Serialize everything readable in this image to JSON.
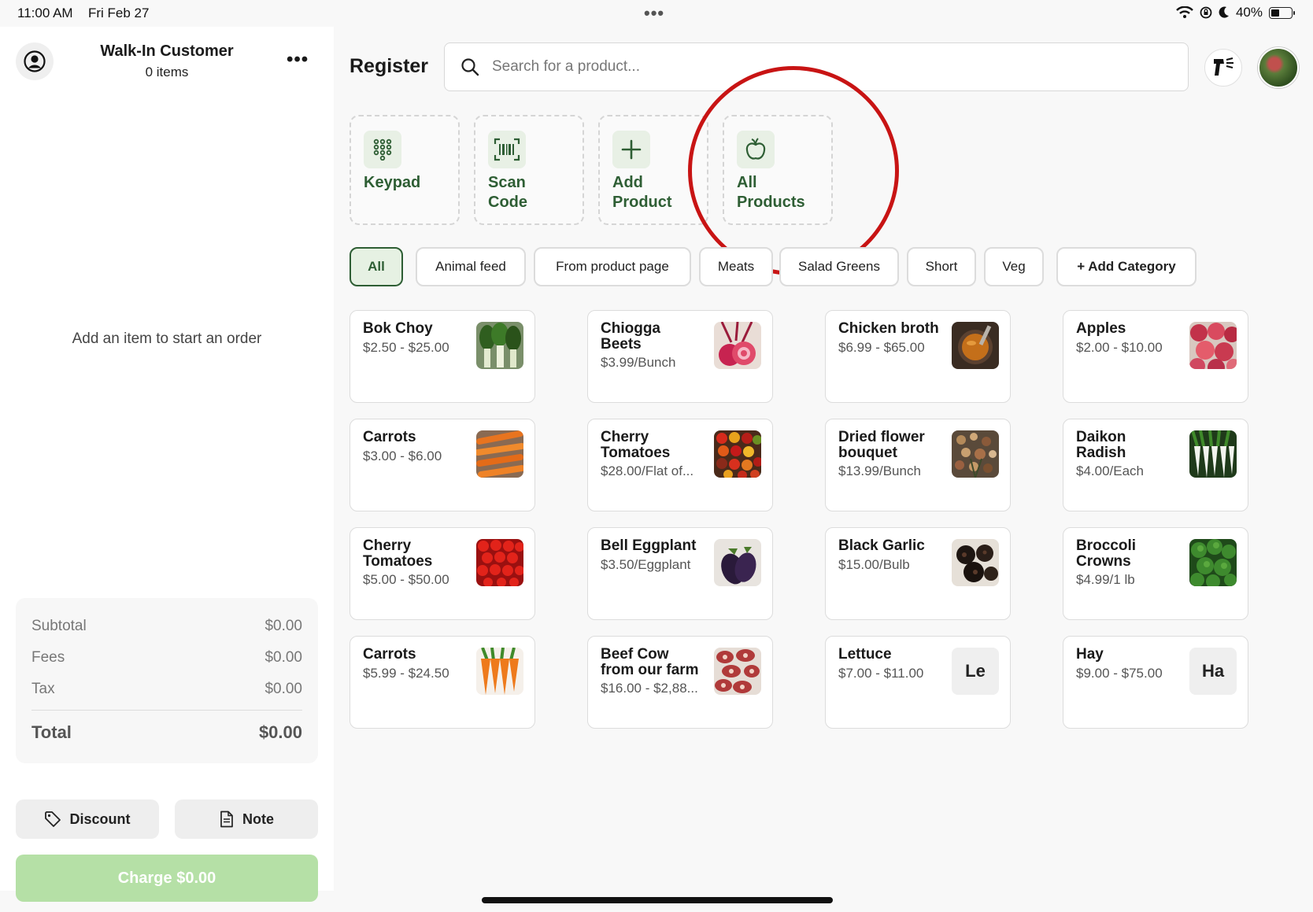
{
  "status": {
    "time": "11:00 AM",
    "date": "Fri Feb 27",
    "multitask": "•••",
    "battery": "40%",
    "battery_level": 0.4
  },
  "customer": {
    "name": "Walk-In Customer",
    "items": "0 items",
    "more": "•••"
  },
  "order": {
    "empty_message": "Add an item to start an order",
    "totals": [
      {
        "label": "Subtotal",
        "value": "$0.00"
      },
      {
        "label": "Fees",
        "value": "$0.00"
      },
      {
        "label": "Tax",
        "value": "$0.00"
      }
    ],
    "total_label": "Total",
    "total_value": "$0.00",
    "discount_label": "Discount",
    "note_label": "Note",
    "charge_label": "Charge $0.00"
  },
  "header": {
    "title": "Register",
    "search_placeholder": "Search for a product..."
  },
  "tiles": [
    {
      "line1": "Keypad",
      "line2": "",
      "icon": "keypad-icon"
    },
    {
      "line1": "Scan",
      "line2": "Code",
      "icon": "barcode-icon"
    },
    {
      "line1": "Add",
      "line2": "Product",
      "icon": "plus-icon"
    },
    {
      "line1": "All",
      "line2": "Products",
      "icon": "apple-icon"
    }
  ],
  "categories": [
    "All",
    "Animal feed",
    "From product page",
    "Meats",
    "Salad Greens",
    "Short",
    "Veg"
  ],
  "add_category": "+ Add Category",
  "colors": {
    "brand_green": "#2e5e34",
    "charge_disabled": "#b5e0a6",
    "annotation_red": "#c81414"
  },
  "products": [
    {
      "l1": "Bok Choy",
      "l2": "",
      "price": "$2.50 - $25.00",
      "img": "bokchoy"
    },
    {
      "l1": "Chiogga",
      "l2": "Beets",
      "price": "$3.99/Bunch",
      "img": "beets"
    },
    {
      "l1": "Chicken broth",
      "l2": "",
      "price": "$6.99 - $65.00",
      "img": "broth"
    },
    {
      "l1": "Apples",
      "l2": "",
      "price": "$2.00 - $10.00",
      "img": "apples"
    },
    {
      "l1": "Carrots",
      "l2": "",
      "price": "$3.00 - $6.00",
      "img": "carrots1"
    },
    {
      "l1": "Cherry",
      "l2": "Tomatoes",
      "price": "$28.00/Flat of...",
      "img": "cherrymix"
    },
    {
      "l1": "Dried flower",
      "l2": "bouquet",
      "price": "$13.99/Bunch",
      "img": "flowers"
    },
    {
      "l1": "Daikon",
      "l2": "Radish",
      "price": "$4.00/Each",
      "img": "daikon"
    },
    {
      "l1": "Cherry",
      "l2": "Tomatoes",
      "price": "$5.00 - $50.00",
      "img": "cherryred"
    },
    {
      "l1": "Bell Eggplant",
      "l2": "",
      "price": "$3.50/Eggplant",
      "img": "eggplant"
    },
    {
      "l1": "Black Garlic",
      "l2": "",
      "price": "$15.00/Bulb",
      "img": "garlic"
    },
    {
      "l1": "Broccoli",
      "l2": "Crowns",
      "price": "$4.99/1 lb",
      "img": "broccoli"
    },
    {
      "l1": "Carrots",
      "l2": "",
      "price": "$5.99 - $24.50",
      "img": "carrots2"
    },
    {
      "l1": "Beef Cow",
      "l2": "from our farm",
      "price": "$16.00 - $2,88...",
      "img": "beef"
    },
    {
      "l1": "Lettuce",
      "l2": "",
      "price": "$7.00 - $11.00",
      "img": "",
      "placeholder": "Le"
    },
    {
      "l1": "Hay",
      "l2": "",
      "price": "$9.00 - $75.00",
      "img": "",
      "placeholder": "Ha"
    }
  ]
}
